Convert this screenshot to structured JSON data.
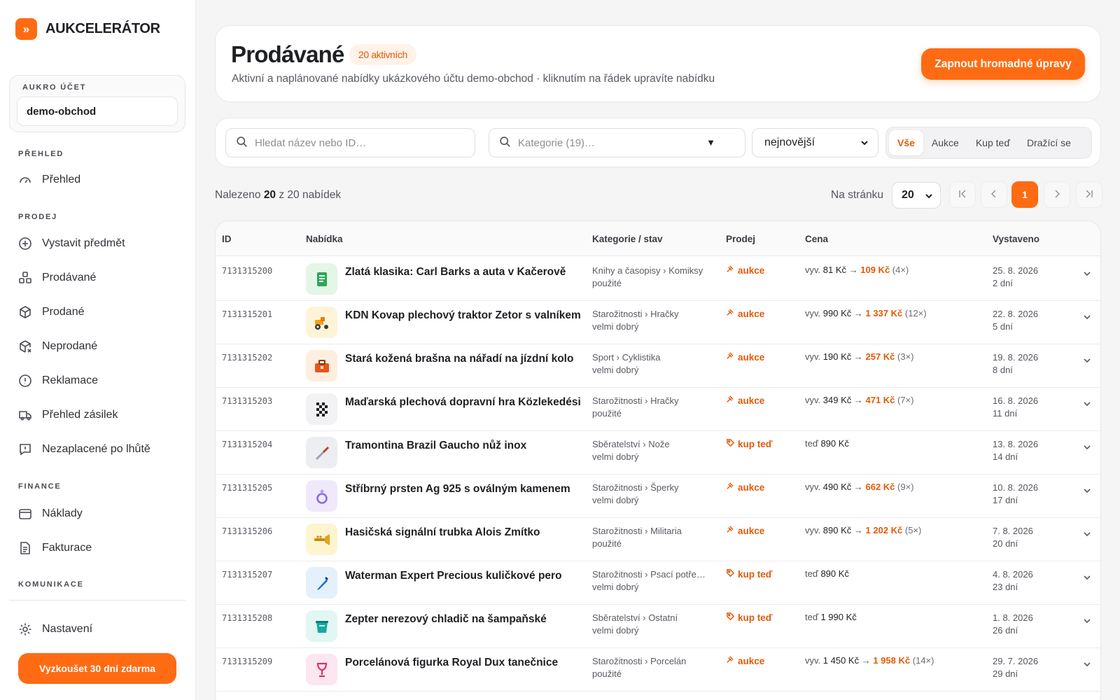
{
  "brand": {
    "logo_glyph": "»",
    "name": "AUKCELERÁTOR",
    "accent": "#ff6b13"
  },
  "account": {
    "label": "AUKRO ÚČET",
    "value": "demo-obchod"
  },
  "sidebar": {
    "sections": [
      {
        "title": "PŘEHLED"
      },
      {
        "title": "PRODEJ"
      },
      {
        "title": "FINANCE"
      },
      {
        "title": "KOMUNIKACE"
      }
    ],
    "items": [
      {
        "label": "Přehled",
        "icon": "gauge-icon"
      },
      {
        "label": "Vystavit předmět",
        "icon": "plus-circle-icon"
      },
      {
        "label": "Prodávané",
        "icon": "boxes-icon"
      },
      {
        "label": "Prodané",
        "icon": "package-icon"
      },
      {
        "label": "Neprodané",
        "icon": "package-x-icon"
      },
      {
        "label": "Reklamace",
        "icon": "alert-circle-icon"
      },
      {
        "label": "Přehled zásilek",
        "icon": "truck-icon"
      },
      {
        "label": "Nezaplacené po lhůtě",
        "icon": "message-alert-icon"
      },
      {
        "label": "Náklady",
        "icon": "wallet-icon"
      },
      {
        "label": "Fakturace",
        "icon": "document-icon"
      },
      {
        "label": "Nastavení",
        "icon": "gear-icon"
      }
    ],
    "trial_button": "Vyzkoušet 30 dní zdarma"
  },
  "header": {
    "title": "Prodávané",
    "badge": "20 aktivních",
    "subtitle": "Aktivní a naplánované nabídky ukázkového účtu demo-obchod · kliknutím na řádek upravíte nabídku",
    "bulk_button": "Zapnout hromadné úpravy"
  },
  "filters": {
    "search_placeholder": "Hledat název nebo ID…",
    "category_placeholder": "Kategorie (19)…",
    "sort_value": "nejnovější",
    "segments": [
      "Vše",
      "Aukce",
      "Kup teď",
      "Dražící se"
    ],
    "active_segment": "Vše"
  },
  "results": {
    "prefix": "Nalezeno",
    "found": "20",
    "suffix": "z 20 nabídek",
    "per_page_label": "Na stránku",
    "per_page_value": "20",
    "current_page": "1",
    "pagination": {
      "first": "K",
      "prev": "‹",
      "next": "›",
      "last": "›|"
    }
  },
  "table": {
    "headers": [
      "ID",
      "Nabídka",
      "Kategorie / stav",
      "Prodej",
      "Cena",
      "Vystaveno"
    ],
    "rows": [
      {
        "id": "7131315200",
        "title": "Zlatá klasika: Carl Barks a auta v Kačerově",
        "category": "Knihy a časopisy › Komiksy",
        "condition": "použité",
        "sale": "aukce",
        "price_from": "vyv. ",
        "price_cur": "81 Kč",
        "price_arrow": " → ",
        "price_hi": "109 Kč",
        "bids": " (4×)",
        "date": "25. 8. 2026",
        "age": "2 dní",
        "thumb_bg": "#e3f6e8",
        "thumb_icon": "book-icon"
      },
      {
        "id": "7131315201",
        "title": "KDN Kovap plechový traktor Zetor s valníkem",
        "category": "Starožitnosti › Hračky",
        "condition": "velmi dobrý",
        "sale": "aukce",
        "price_from": "vyv. ",
        "price_cur": "990 Kč",
        "price_arrow": " → ",
        "price_hi": "1 337 Kč",
        "bids": " (12×)",
        "date": "22. 8. 2026",
        "age": "5 dní",
        "thumb_bg": "#fdf4d8",
        "thumb_icon": "tractor-icon"
      },
      {
        "id": "7131315202",
        "title": "Stará kožená brašna na nářadí na jízdní kolo",
        "category": "Sport › Cyklistika",
        "condition": "velmi dobrý",
        "sale": "aukce",
        "price_from": "vyv. ",
        "price_cur": "190 Kč",
        "price_arrow": " → ",
        "price_hi": "257 Kč",
        "bids": " (3×)",
        "date": "19. 8. 2026",
        "age": "8 dní",
        "thumb_bg": "#fdeee0",
        "thumb_icon": "toolbox-icon"
      },
      {
        "id": "7131315203",
        "title": "Maďarská plechová dopravní hra Közlekedési",
        "category": "Starožitnosti › Hračky",
        "condition": "použité",
        "sale": "aukce",
        "price_from": "vyv. ",
        "price_cur": "349 Kč",
        "price_arrow": " → ",
        "price_hi": "471 Kč",
        "bids": " (7×)",
        "date": "16. 8. 2026",
        "age": "11 dní",
        "thumb_bg": "#f2f2f4",
        "thumb_icon": "checker-icon"
      },
      {
        "id": "7131315204",
        "title": "Tramontina Brazil Gaucho nůž inox",
        "category": "Sběratelství › Nože",
        "condition": "velmi dobrý",
        "sale": "kup teď",
        "price_from": "teď ",
        "price_cur": "890 Kč",
        "price_arrow": "",
        "price_hi": "",
        "bids": "",
        "date": "13. 8. 2026",
        "age": "14 dní",
        "thumb_bg": "#eceef2",
        "thumb_icon": "knife-icon"
      },
      {
        "id": "7131315205",
        "title": "Stříbrný prsten Ag 925 s oválným kamenem",
        "category": "Starožitnosti › Šperky",
        "condition": "velmi dobrý",
        "sale": "aukce",
        "price_from": "vyv. ",
        "price_cur": "490 Kč",
        "price_arrow": " → ",
        "price_hi": "662 Kč",
        "bids": " (9×)",
        "date": "10. 8. 2026",
        "age": "17 dní",
        "thumb_bg": "#efe9fb",
        "thumb_icon": "ring-icon"
      },
      {
        "id": "7131315206",
        "title": "Hasičská signální trubka Alois Zmítko",
        "category": "Starožitnosti › Militaria",
        "condition": "použité",
        "sale": "aukce",
        "price_from": "vyv. ",
        "price_cur": "890 Kč",
        "price_arrow": " → ",
        "price_hi": "1 202 Kč",
        "bids": " (5×)",
        "date": "7. 8. 2026",
        "age": "20 dní",
        "thumb_bg": "#fdf4d0",
        "thumb_icon": "trumpet-icon"
      },
      {
        "id": "7131315207",
        "title": "Waterman Expert Precious kuličkové pero",
        "category": "Starožitnosti › Psací potře…",
        "condition": "velmi dobrý",
        "sale": "kup teď",
        "price_from": "teď ",
        "price_cur": "890 Kč",
        "price_arrow": "",
        "price_hi": "",
        "bids": "",
        "date": "4. 8. 2026",
        "age": "23 dní",
        "thumb_bg": "#e4f1fb",
        "thumb_icon": "pen-icon"
      },
      {
        "id": "7131315208",
        "title": "Zepter nerezový chladič na šampaňské",
        "category": "Sběratelství › Ostatní",
        "condition": "velmi dobrý",
        "sale": "kup teď",
        "price_from": "teď ",
        "price_cur": "1 990 Kč",
        "price_arrow": "",
        "price_hi": "",
        "bids": "",
        "date": "1. 8. 2026",
        "age": "26 dní",
        "thumb_bg": "#e2f6f4",
        "thumb_icon": "bucket-icon"
      },
      {
        "id": "7131315209",
        "title": "Porcelánová figurka Royal Dux tanečnice",
        "category": "Starožitnosti › Porcelán",
        "condition": "použité",
        "sale": "aukce",
        "price_from": "vyv. ",
        "price_cur": "1 450 Kč",
        "price_arrow": " → ",
        "price_hi": "1 958 Kč",
        "bids": " (14×)",
        "date": "29. 7. 2026",
        "age": "29 dní",
        "thumb_bg": "#fce6ef",
        "thumb_icon": "goblet-icon"
      }
    ]
  }
}
